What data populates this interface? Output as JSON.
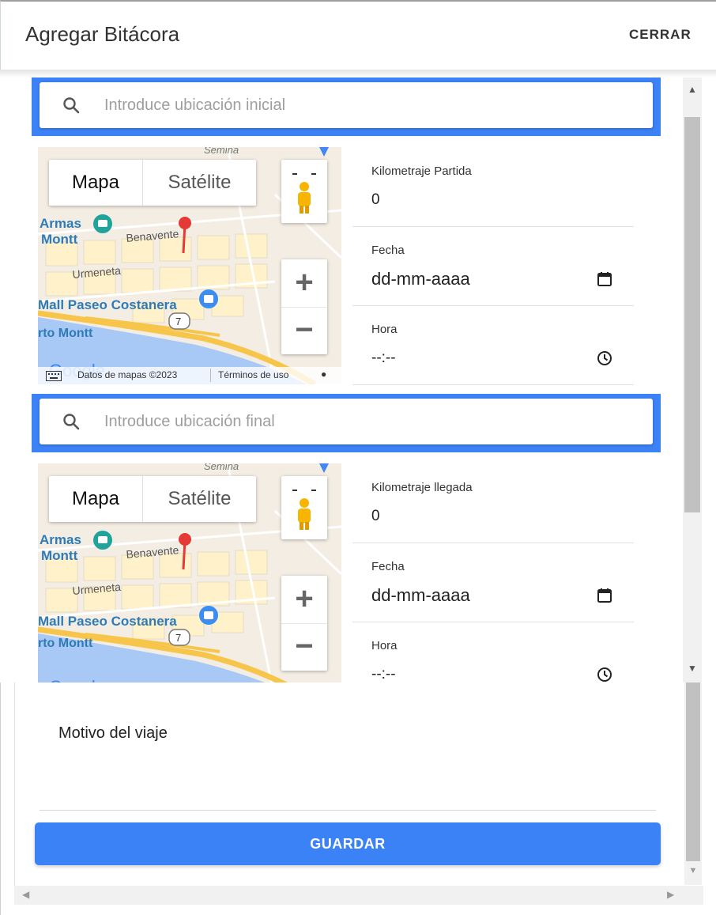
{
  "dialog": {
    "title": "Agregar Bitácora",
    "close_label": "CERRAR"
  },
  "map_labels": {
    "type_map": "Mapa",
    "type_satellite": "Satélite",
    "zoom_in": "+",
    "zoom_out": "−",
    "place_armas": "Armas",
    "place_montt": "Montt",
    "place_benavente": "Benavente",
    "place_urmeneta": "Urmeneta",
    "place_mall": "Mall Paseo Costanera",
    "place_rto": "rto Montt",
    "place_semina": "Semina",
    "route_7": "7",
    "google": "Google",
    "attribution_data": "Datos de mapas ©2023",
    "attribution_terms": "Términos de uso"
  },
  "start": {
    "search_placeholder": "Introduce ubicación inicial",
    "km_label": "Kilometraje Partida",
    "km_value": "0",
    "date_label": "Fecha",
    "date_value": "dd-mm-aaaa",
    "time_label": "Hora",
    "time_value": "--:--"
  },
  "end": {
    "search_placeholder": "Introduce ubicación final",
    "km_label": "Kilometraje llegada",
    "km_value": "0",
    "date_label": "Fecha",
    "date_value": "dd-mm-aaaa",
    "time_label": "Hora",
    "time_value": "--:--"
  },
  "form": {
    "reason_placeholder": "Motivo del viaje",
    "save_label": "GUARDAR"
  },
  "colors": {
    "accent": "#3b82f6",
    "pin": "#e53935",
    "road": "#f6c54a",
    "water": "#a3c7f7"
  },
  "icons": [
    "search-icon",
    "calendar-icon",
    "clock-icon",
    "pegman-icon",
    "map-pin-icon",
    "keyboard-icon",
    "camera-poi-icon",
    "shopping-poi-icon"
  ]
}
